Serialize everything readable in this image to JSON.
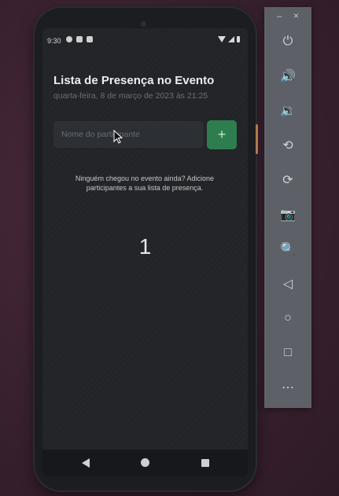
{
  "status": {
    "time": "9:30"
  },
  "app": {
    "title": "Lista de Presença no Evento",
    "date": "quarta-feira, 8 de março de 2023 às 21:25",
    "input_placeholder": "Nome do participante",
    "add_button_label": "+",
    "empty_message": "Ninguém chegou no evento ainda? Adicione participantes a sua lista de presença.",
    "overlay_number": "1"
  },
  "emulator_toolbar": {
    "minimize": "–",
    "close": "×",
    "items": [
      {
        "name": "power-icon",
        "glyph": "⏻"
      },
      {
        "name": "volume-up-icon",
        "glyph": "🔊"
      },
      {
        "name": "volume-down-icon",
        "glyph": "🔉"
      },
      {
        "name": "rotate-left-icon",
        "glyph": "⟲"
      },
      {
        "name": "rotate-right-icon",
        "glyph": "⟳"
      },
      {
        "name": "camera-icon",
        "glyph": "📷"
      },
      {
        "name": "zoom-icon",
        "glyph": "🔍"
      },
      {
        "name": "back-icon",
        "glyph": "◁"
      },
      {
        "name": "home-icon",
        "glyph": "○"
      },
      {
        "name": "overview-icon",
        "glyph": "□"
      },
      {
        "name": "more-icon",
        "glyph": "⋯"
      }
    ]
  }
}
